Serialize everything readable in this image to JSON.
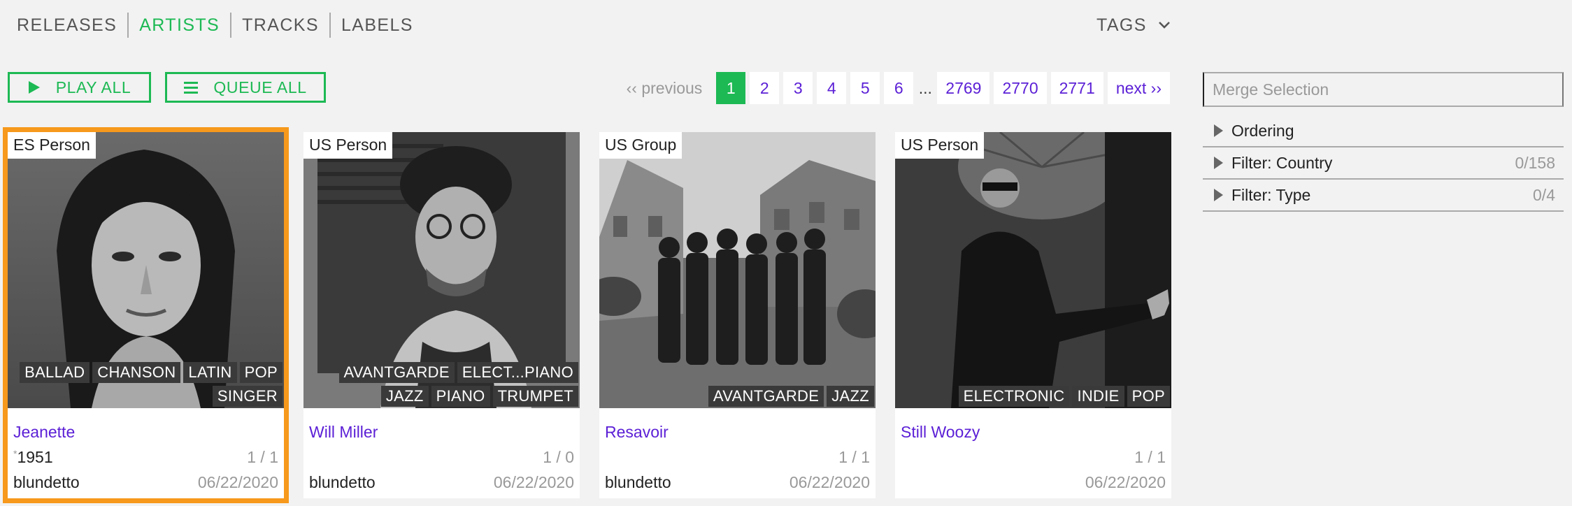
{
  "nav": {
    "items": [
      {
        "label": "RELEASES"
      },
      {
        "label": "ARTISTS"
      },
      {
        "label": "TRACKS"
      },
      {
        "label": "LABELS"
      }
    ],
    "active": "ARTISTS",
    "tags_label": "TAGS"
  },
  "actions": {
    "play_all": "PLAY ALL",
    "queue_all": "QUEUE ALL"
  },
  "pagination": {
    "previous": "‹‹ previous",
    "pages": [
      "1",
      "2",
      "3",
      "4",
      "5",
      "6"
    ],
    "ellipsis": "...",
    "last_pages": [
      "2769",
      "2770",
      "2771"
    ],
    "next": "next ››",
    "current": "1"
  },
  "artists": [
    {
      "type": "ES Person",
      "tag_rows": [
        [
          "BALLAD",
          "CHANSON",
          "LATIN",
          "POP"
        ],
        [
          "SINGER"
        ]
      ],
      "name": "Jeanette",
      "born_marker": "*",
      "born": "1951",
      "counts": "1 / 1",
      "user": "blundetto",
      "date": "06/22/2020",
      "selected": true
    },
    {
      "type": "US Person",
      "tag_rows": [
        [
          "AVANTGARDE",
          "ELECT...PIANO"
        ],
        [
          "JAZZ",
          "PIANO",
          "TRUMPET"
        ]
      ],
      "name": "Will Miller",
      "born_marker": "",
      "born": "",
      "counts": "1 / 0",
      "user": "blundetto",
      "date": "06/22/2020",
      "selected": false
    },
    {
      "type": "US Group",
      "tag_rows": [
        [
          "AVANTGARDE",
          "JAZZ"
        ]
      ],
      "name": "Resavoir",
      "born_marker": "",
      "born": "",
      "counts": "1 / 1",
      "user": "blundetto",
      "date": "06/22/2020",
      "selected": false
    },
    {
      "type": "US Person",
      "tag_rows": [
        [
          "ELECTRONIC",
          "INDIE",
          "POP"
        ]
      ],
      "name": "Still Woozy",
      "born_marker": "",
      "born": "",
      "counts": "1 / 1",
      "user": "",
      "date": "06/22/2020",
      "selected": false
    }
  ],
  "side_panel": {
    "merge_placeholder": "Merge Selection",
    "rows": [
      {
        "label": "Ordering",
        "count": ""
      },
      {
        "label": "Filter: Country",
        "count": "0/158"
      },
      {
        "label": "Filter: Type",
        "count": "0/4"
      }
    ]
  },
  "colors": {
    "accent": "#1db954",
    "link": "#5b1fd6",
    "selection": "#f7991c",
    "background": "#f2f2f2"
  },
  "icons": {
    "play": "play-icon",
    "queue": "list-icon",
    "tags": "chevron-down-icon",
    "panel_rows": "triangle-right-icon"
  }
}
